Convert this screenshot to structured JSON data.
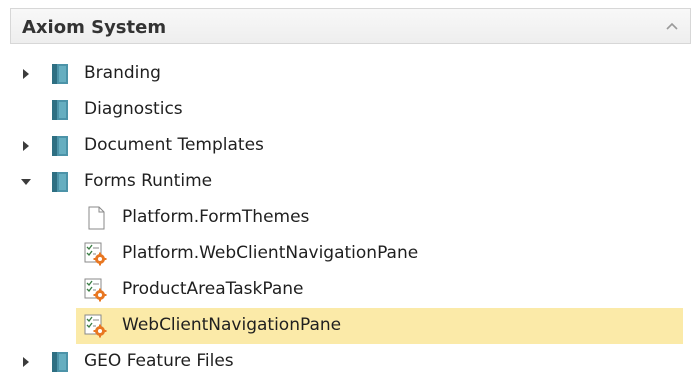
{
  "panel": {
    "title": "Axiom System",
    "collapse_icon": "chevron-up-icon"
  },
  "tree": {
    "branding": {
      "label": "Branding",
      "icon": "book-icon",
      "expander": "collapsed"
    },
    "diagnostics": {
      "label": "Diagnostics",
      "icon": "book-icon"
    },
    "document_templates": {
      "label": "Document Templates",
      "icon": "book-icon",
      "expander": "collapsed"
    },
    "forms_runtime": {
      "label": "Forms Runtime",
      "icon": "book-icon",
      "expander": "expanded",
      "children": [
        {
          "label": "Platform.FormThemes",
          "icon": "document-icon"
        },
        {
          "label": "Platform.WebClientNavigationPane",
          "icon": "config-form-icon"
        },
        {
          "label": "ProductAreaTaskPane",
          "icon": "config-form-icon"
        },
        {
          "label": "WebClientNavigationPane",
          "icon": "config-form-icon",
          "selected": true
        }
      ]
    },
    "geo_feature_files": {
      "label": "GEO Feature Files",
      "icon": "book-icon",
      "expander": "collapsed"
    }
  },
  "colors": {
    "selection": "#fbeaa8",
    "book_icon": "#3b7b8e",
    "gear": "#e87722"
  }
}
